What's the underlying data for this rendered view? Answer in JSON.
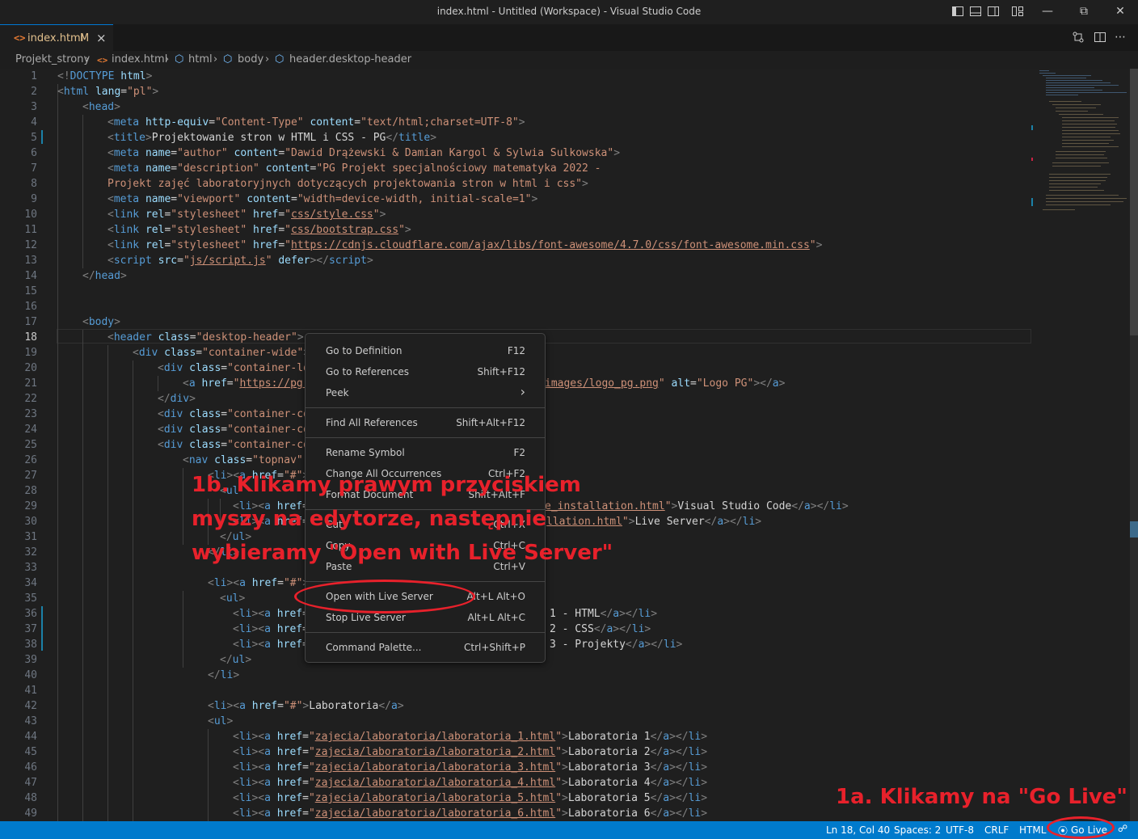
{
  "window": {
    "title": "index.html - Untitled (Workspace) - Visual Studio Code"
  },
  "tab": {
    "label": "index.html",
    "modified_marker": "M",
    "close_glyph": "×",
    "file_icon": "<>"
  },
  "breadcrumb": [
    "Projekt_strony",
    "index.html",
    "html",
    "body",
    "header.desktop-header"
  ],
  "line_numbers": [
    "1",
    "2",
    "3",
    "4",
    "5",
    "6",
    "7",
    "8",
    "9",
    "10",
    "11",
    "12",
    "13",
    "14",
    "15",
    "16",
    "17",
    "18",
    "19",
    "20",
    "21",
    "22",
    "23",
    "24",
    "25",
    "26",
    "27",
    "28",
    "29",
    "30",
    "31",
    "32",
    "33",
    "34",
    "35",
    "36",
    "37",
    "38",
    "39",
    "40",
    "41",
    "42",
    "43",
    "44",
    "45",
    "46",
    "47",
    "48",
    "49"
  ],
  "code": {
    "l1": [
      "<!",
      "DOCTYPE",
      " html",
      ">"
    ],
    "l2": [
      "<",
      "html",
      " lang",
      "=",
      "\"pl\"",
      ">"
    ],
    "l3": [
      "<",
      "head",
      ">"
    ],
    "l4": [
      "<",
      "meta",
      " http-equiv",
      "=",
      "\"Content-Type\"",
      " content",
      "=",
      "\"text/html;charset=UTF-8\"",
      ">"
    ],
    "l5": [
      "<",
      "title",
      ">",
      "Projektowanie stron w HTML i CSS - PG",
      "</",
      "title",
      ">"
    ],
    "l6": [
      "<",
      "meta",
      " name",
      "=",
      "\"author\"",
      " content",
      "=",
      "\"Dawid Drążewski & Damian Kargol & Sylwia Sulkowska\"",
      ">"
    ],
    "l7": [
      "<",
      "meta",
      " name",
      "=",
      "\"description\"",
      " content",
      "=",
      "\"PG Projekt specjalnościowy matematyka 2022 -"
    ],
    "l8": [
      "Projekt zajęć laboratoryjnych dotyczących projektowania stron w html i css\"",
      ">"
    ],
    "l9": [
      "<",
      "meta",
      " name",
      "=",
      "\"viewport\"",
      " content",
      "=",
      "\"width=device-width, initial-scale=1\"",
      ">"
    ],
    "l10": [
      "<",
      "link",
      " rel",
      "=",
      "\"stylesheet\"",
      " href",
      "=",
      "\"",
      "css/style.css",
      "\"",
      ">"
    ],
    "l11": [
      "<",
      "link",
      " rel",
      "=",
      "\"stylesheet\"",
      " href",
      "=",
      "\"",
      "css/bootstrap.css",
      "\"",
      ">"
    ],
    "l12": [
      "<",
      "link",
      " rel",
      "=",
      "\"stylesheet\"",
      " href",
      "=",
      "\"",
      "https://cdnjs.cloudflare.com/ajax/libs/font-awesome/4.7.0/css/font-awesome.min.css",
      "\"",
      ">"
    ],
    "l13": [
      "<",
      "script",
      " src",
      "=",
      "\"",
      "js/script.js",
      "\"",
      " defer",
      "></",
      "script",
      ">"
    ],
    "l14": [
      "</",
      "head",
      ">"
    ],
    "l17": [
      "<",
      "body",
      ">"
    ],
    "l18": [
      "<",
      "header",
      " class",
      "=",
      "\"desktop-header\"",
      ">"
    ],
    "l19": [
      "<",
      "div",
      " class",
      "=",
      "\"container-wide\"",
      ">"
    ],
    "l20": [
      "<",
      "div",
      " class",
      "=",
      "\"container-lo"
    ],
    "l21a": [
      "<",
      "a",
      " href",
      "=",
      "\"",
      "https://pg."
    ],
    "l21b": [
      "images/logo_pg.png",
      "\"",
      " alt",
      "=",
      "\"Logo PG\"",
      "></",
      "a",
      ">"
    ],
    "l22": [
      "</",
      "div",
      ">"
    ],
    "l23": [
      "<",
      "div",
      " class",
      "=",
      "\"container-co"
    ],
    "l24": [
      "<",
      "div",
      " class",
      "=",
      "\"container-co"
    ],
    "l25": [
      "<",
      "div",
      " class",
      "=",
      "\"container-co"
    ],
    "l26": [
      "<",
      "nav",
      " class",
      "=",
      "\"topnav\""
    ],
    "l27": [
      "<",
      "li",
      "><",
      "a",
      " href",
      "=",
      "\"#\"",
      ">"
    ],
    "l28": [
      "<",
      "ul"
    ],
    "l29a": [
      "<",
      "li",
      "><",
      "a",
      " href",
      "="
    ],
    "l29b": [
      "e_installation.html",
      "\"",
      ">",
      "Visual Studio Code",
      "</",
      "a",
      "></",
      "li",
      ">"
    ],
    "l30a": [
      "<",
      "li",
      "><",
      "a",
      " href",
      "="
    ],
    "l30b": [
      "llation.html",
      "\"",
      ">",
      "Live Server",
      "</",
      "a",
      "></",
      "li",
      ">"
    ],
    "l31": [
      "</",
      "ul",
      ">"
    ],
    "l32": [
      "</",
      "li",
      ">"
    ],
    "l34": [
      "<",
      "li",
      "><",
      "a",
      " href",
      "=",
      "\"#\"",
      ">"
    ],
    "l35": [
      "<",
      "ul",
      ">"
    ],
    "l36a": [
      "<",
      "li",
      "><",
      "a",
      " href",
      "="
    ],
    "l36b": [
      "1 - HTML",
      "</",
      "a",
      "></",
      "li",
      ">"
    ],
    "l37a": [
      "<",
      "li",
      "><",
      "a",
      " href",
      "="
    ],
    "l37b": [
      "2 - CSS",
      "</",
      "a",
      "></",
      "li",
      ">"
    ],
    "l38a": [
      "<",
      "li",
      "><",
      "a",
      " href",
      "="
    ],
    "l38b": [
      "3 - Projekty",
      "</",
      "a",
      "></",
      "li",
      ">"
    ],
    "l39": [
      "</",
      "ul",
      ">"
    ],
    "l40": [
      "</",
      "li",
      ">"
    ],
    "l42": [
      "<",
      "li",
      "><",
      "a",
      " href",
      "=",
      "\"#\"",
      ">",
      "Laboratoria",
      "</",
      "a",
      ">"
    ],
    "l43": [
      "<",
      "ul",
      ">"
    ],
    "l44": [
      "<",
      "li",
      "><",
      "a",
      " href",
      "=",
      "\"",
      "zajecia/laboratoria/laboratoria_1.html",
      "\"",
      ">",
      "Laboratoria 1",
      "</",
      "a",
      "></",
      "li",
      ">"
    ],
    "l45": [
      "<",
      "li",
      "><",
      "a",
      " href",
      "=",
      "\"",
      "zajecia/laboratoria/laboratoria_2.html",
      "\"",
      ">",
      "Laboratoria 2",
      "</",
      "a",
      "></",
      "li",
      ">"
    ],
    "l46": [
      "<",
      "li",
      "><",
      "a",
      " href",
      "=",
      "\"",
      "zajecia/laboratoria/laboratoria_3.html",
      "\"",
      ">",
      "Laboratoria 3",
      "</",
      "a",
      "></",
      "li",
      ">"
    ],
    "l47": [
      "<",
      "li",
      "><",
      "a",
      " href",
      "=",
      "\"",
      "zajecia/laboratoria/laboratoria_4.html",
      "\"",
      ">",
      "Laboratoria 4",
      "</",
      "a",
      "></",
      "li",
      ">"
    ],
    "l48": [
      "<",
      "li",
      "><",
      "a",
      " href",
      "=",
      "\"",
      "zajecia/laboratoria/laboratoria_5.html",
      "\"",
      ">",
      "Laboratoria 5",
      "</",
      "a",
      "></",
      "li",
      ">"
    ],
    "l49": [
      "<",
      "li",
      "><",
      "a",
      " href",
      "=",
      "\"",
      "zajecia/laboratoria/laboratoria_6.html",
      "\"",
      ">",
      "Laboratoria 6",
      "</",
      "a",
      "></",
      "li",
      ">"
    ]
  },
  "context_menu": {
    "items": [
      {
        "label": "Go to Definition",
        "key": "F12"
      },
      {
        "label": "Go to References",
        "key": "Shift+F12"
      },
      {
        "label": "Peek",
        "key": "›"
      },
      {
        "label": "Find All References",
        "key": "Shift+Alt+F12"
      },
      {
        "label": "Rename Symbol",
        "key": "F2"
      },
      {
        "label": "Change All Occurrences",
        "key": "Ctrl+F2"
      },
      {
        "label": "Format Document",
        "key": "Shift+Alt+F"
      },
      {
        "label": "Cut",
        "key": "Ctrl+X"
      },
      {
        "label": "Copy",
        "key": "Ctrl+C"
      },
      {
        "label": "Paste",
        "key": "Ctrl+V"
      },
      {
        "label": "Open with Live Server",
        "key": "Alt+L Alt+O"
      },
      {
        "label": "Stop Live Server",
        "key": "Alt+L Alt+C"
      },
      {
        "label": "Command Palette...",
        "key": "Ctrl+Shift+P"
      }
    ]
  },
  "annotations": {
    "step_1b": [
      "1b. Klikamy prawym przyciskiem",
      "myszy na edytorze, następnie",
      "wybieramy \"Open with Live Server\""
    ],
    "step_1a": "1a. Klikamy na \"Go Live\"",
    "highlight_color": "#e8212b"
  },
  "statusbar": {
    "position": "Ln 18, Col 40",
    "spaces": "Spaces: 2",
    "encoding": "UTF-8",
    "eol": "CRLF",
    "language": "HTML",
    "go_live": "Go Live",
    "background": "#007acc"
  }
}
